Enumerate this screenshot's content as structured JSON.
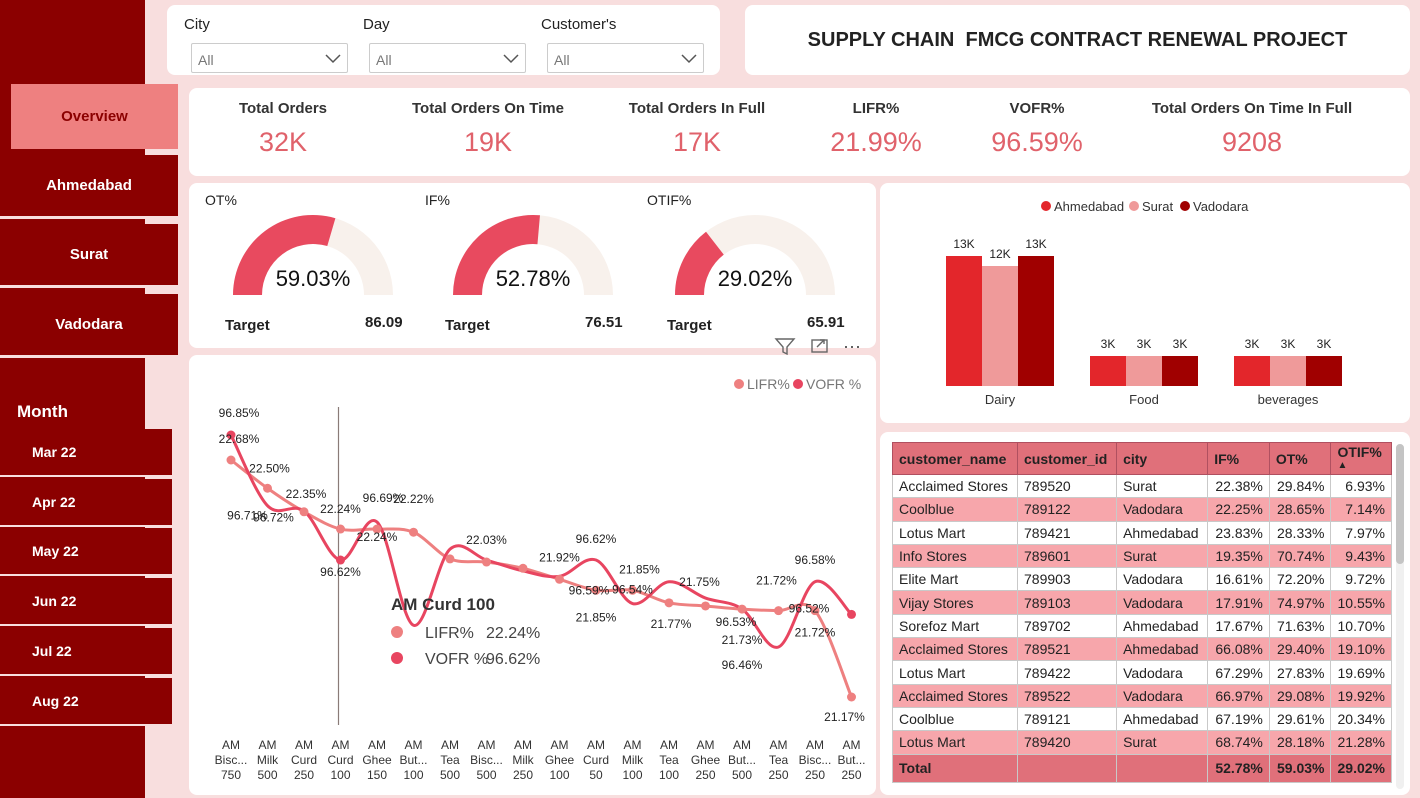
{
  "title": "SUPPLY CHAIN  FMCG CONTRACT RENEWAL PROJECT",
  "filters": [
    {
      "label": "City",
      "value": "All"
    },
    {
      "label": "Day",
      "value": "All"
    },
    {
      "label": "Customer's",
      "value": "All"
    }
  ],
  "nav": [
    "Overview",
    "Ahmedabad",
    "Surat",
    "Vadodara"
  ],
  "month_title": "Month",
  "months": [
    "Mar 22",
    "Apr 22",
    "May 22",
    "Jun 22",
    "Jul 22",
    "Aug 22"
  ],
  "kpis": [
    {
      "label": "Total Orders",
      "value": "32K"
    },
    {
      "label": "Total Orders On Time",
      "value": "19K"
    },
    {
      "label": "Total Orders In Full",
      "value": "17K"
    },
    {
      "label": "LIFR%",
      "value": "21.99%"
    },
    {
      "label": "VOFR%",
      "value": "96.59%"
    },
    {
      "label": "Total Orders On Time In Full",
      "value": "9208"
    }
  ],
  "gauges": [
    {
      "title": "OT%",
      "value": "59.03%",
      "fraction": 0.5903,
      "target_label": "Target",
      "target": "86.09"
    },
    {
      "title": "IF%",
      "value": "52.78%",
      "fraction": 0.5278,
      "target_label": "Target",
      "target": "76.51"
    },
    {
      "title": "OTIF%",
      "value": "29.02%",
      "fraction": 0.2902,
      "target_label": "Target",
      "target": "65.91"
    }
  ],
  "colors": {
    "sidebar": "#8b0000",
    "accent": "#e0626b",
    "ahmedabad": "#e3262b",
    "surat": "#ef9a9a",
    "vadodara": "#a00000",
    "lifr": "#ee8080",
    "vofr": "#e84560"
  },
  "chart_data": [
    {
      "type": "line",
      "title": "",
      "legend": [
        "LIFR%",
        "VOFR %"
      ],
      "x": [
        "AM Bisc... 750",
        "AM Milk 500",
        "AM Curd 250",
        "AM Curd 100",
        "AM Ghee 150",
        "AM But... 100",
        "AM Tea 500",
        "AM Bisc... 500",
        "AM Milk 250",
        "AM Ghee 100",
        "AM Curd 50",
        "AM Milk 100",
        "AM Tea 100",
        "AM Ghee 250",
        "AM But... 500",
        "AM Tea 250",
        "AM Bisc... 250",
        "AM But... 250"
      ],
      "x_lines": [
        [
          "AM",
          "Bisc...",
          "750"
        ],
        [
          "AM",
          "Milk",
          "500"
        ],
        [
          "AM",
          "Curd",
          "250"
        ],
        [
          "AM",
          "Curd",
          "100"
        ],
        [
          "AM",
          "Ghee",
          "150"
        ],
        [
          "AM",
          "But...",
          "100"
        ],
        [
          "AM",
          "Tea",
          "500"
        ],
        [
          "AM",
          "Bisc...",
          "500"
        ],
        [
          "AM",
          "Milk",
          "250"
        ],
        [
          "AM",
          "Ghee",
          "100"
        ],
        [
          "AM",
          "Curd",
          "50"
        ],
        [
          "AM",
          "Milk",
          "100"
        ],
        [
          "AM",
          "Tea",
          "100"
        ],
        [
          "AM",
          "Ghee",
          "250"
        ],
        [
          "AM",
          "But...",
          "500"
        ],
        [
          "AM",
          "Tea",
          "250"
        ],
        [
          "AM",
          "Bisc...",
          "250"
        ],
        [
          "AM",
          "But...",
          "250"
        ]
      ],
      "series": [
        {
          "name": "LIFR%",
          "values": [
            22.68,
            22.5,
            22.35,
            22.24,
            22.24,
            22.22,
            22.05,
            22.03,
            21.99,
            21.92,
            21.85,
            21.85,
            21.77,
            21.75,
            21.73,
            21.72,
            21.72,
            21.17
          ]
        },
        {
          "name": "VOFR %",
          "values": [
            96.85,
            96.72,
            96.71,
            96.62,
            96.69,
            96.5,
            96.64,
            96.62,
            96.6,
            96.59,
            96.62,
            96.54,
            96.58,
            96.55,
            96.53,
            96.46,
            96.58,
            96.52
          ]
        }
      ],
      "data_labels": [
        {
          "text": "96.85%",
          "i": 0,
          "s": 1,
          "dx": 8,
          "dy": -18
        },
        {
          "text": "22.68%",
          "i": 0,
          "s": 0,
          "dx": 8,
          "dy": -17
        },
        {
          "text": "22.50%",
          "i": 1,
          "s": 0,
          "dx": 2,
          "dy": -16
        },
        {
          "text": "96.72%",
          "i": 1,
          "s": 1,
          "dx": 6,
          "dy": 16
        },
        {
          "text": "96.71%",
          "i": 1,
          "s": 0,
          "dx": -20,
          "dy": 31
        },
        {
          "text": "22.35%",
          "i": 2,
          "s": 0,
          "dx": 2,
          "dy": -14
        },
        {
          "text": "22.24%",
          "i": 3,
          "s": 0,
          "dx": 0,
          "dy": -16
        },
        {
          "text": "96.62%",
          "i": 3,
          "s": 1,
          "dx": 0,
          "dy": 16
        },
        {
          "text": "96.69%",
          "i": 4,
          "s": 1,
          "dx": 6,
          "dy": -20
        },
        {
          "text": "22.24%",
          "i": 4,
          "s": 0,
          "dx": 0,
          "dy": 12
        },
        {
          "text": "22.22%",
          "i": 5,
          "s": 0,
          "dx": 0,
          "dy": -29
        },
        {
          "text": "22.03%",
          "i": 7,
          "s": 0,
          "dx": 0,
          "dy": -18
        },
        {
          "text": "21.92%",
          "i": 9,
          "s": 0,
          "dx": 0,
          "dy": -18
        },
        {
          "text": "96.62%",
          "i": 10,
          "s": 1,
          "dx": 0,
          "dy": -17
        },
        {
          "text": "96.59%",
          "i": 10,
          "s": 0,
          "dx": -7,
          "dy": 4
        },
        {
          "text": "21.85%",
          "i": 10,
          "s": 0,
          "dx": 0,
          "dy": 31
        },
        {
          "text": "21.85%",
          "i": 11,
          "s": 0,
          "dx": 7,
          "dy": -17
        },
        {
          "text": "96.54%",
          "i": 11,
          "s": 0,
          "dx": 0,
          "dy": 3
        },
        {
          "text": "21.77%",
          "i": 12,
          "s": 0,
          "dx": 2,
          "dy": 25
        },
        {
          "text": "21.75%",
          "i": 13,
          "s": 0,
          "dx": -6,
          "dy": -20
        },
        {
          "text": "96.53%",
          "i": 14,
          "s": 0,
          "dx": -6,
          "dy": 17
        },
        {
          "text": "21.73%",
          "i": 14,
          "s": 0,
          "dx": 0,
          "dy": 35
        },
        {
          "text": "96.46%",
          "i": 14,
          "s": 0,
          "dx": 0,
          "dy": 60
        },
        {
          "text": "21.72%",
          "i": 15,
          "s": 0,
          "dx": -2,
          "dy": -26
        },
        {
          "text": "96.52%",
          "i": 16,
          "s": 0,
          "dx": -6,
          "dy": 2
        },
        {
          "text": "96.58%",
          "i": 16,
          "s": 1,
          "dx": 0,
          "dy": -18
        },
        {
          "text": "21.72%",
          "i": 16,
          "s": 0,
          "dx": 0,
          "dy": 26
        },
        {
          "text": "21.17%",
          "i": 17,
          "s": 0,
          "dx": -7,
          "dy": 24
        }
      ],
      "tooltip": {
        "title": "AM Curd 100",
        "rows": [
          {
            "name": "LIFR%",
            "value": "22.24%"
          },
          {
            "name": "VOFR %",
            "value": "96.62%"
          }
        ]
      },
      "grid": false,
      "legend_position": "top-right"
    },
    {
      "type": "bar",
      "title": "",
      "legend": [
        "Ahmedabad",
        "Surat",
        "Vadodara"
      ],
      "categories": [
        "Dairy",
        "Food",
        "beverages"
      ],
      "series": [
        {
          "name": "Ahmedabad",
          "values": [
            13000,
            3000,
            3000
          ],
          "labels": [
            "13K",
            "3K",
            "3K"
          ]
        },
        {
          "name": "Surat",
          "values": [
            12000,
            3000,
            3000
          ],
          "labels": [
            "12K",
            "3K",
            "3K"
          ]
        },
        {
          "name": "Vadodara",
          "values": [
            13000,
            3000,
            3000
          ],
          "labels": [
            "13K",
            "3K",
            "3K"
          ]
        }
      ],
      "legend_position": "top-center"
    }
  ],
  "table": {
    "headers": [
      "customer_name",
      "customer_id",
      "city",
      "IF%",
      "OT%",
      "OTIF%"
    ],
    "sort_indicator": "▲",
    "rows": [
      [
        "Acclaimed Stores",
        "789520",
        "Surat",
        "22.38%",
        "29.84%",
        "6.93%"
      ],
      [
        "Coolblue",
        "789122",
        "Vadodara",
        "22.25%",
        "28.65%",
        "7.14%"
      ],
      [
        "Lotus Mart",
        "789421",
        "Ahmedabad",
        "23.83%",
        "28.33%",
        "7.97%"
      ],
      [
        "Info Stores",
        "789601",
        "Surat",
        "19.35%",
        "70.74%",
        "9.43%"
      ],
      [
        "Elite Mart",
        "789903",
        "Vadodara",
        "16.61%",
        "72.20%",
        "9.72%"
      ],
      [
        "Vijay Stores",
        "789103",
        "Vadodara",
        "17.91%",
        "74.97%",
        "10.55%"
      ],
      [
        "Sorefoz Mart",
        "789702",
        "Ahmedabad",
        "17.67%",
        "71.63%",
        "10.70%"
      ],
      [
        "Acclaimed Stores",
        "789521",
        "Ahmedabad",
        "66.08%",
        "29.40%",
        "19.10%"
      ],
      [
        "Lotus Mart",
        "789422",
        "Vadodara",
        "67.29%",
        "27.83%",
        "19.69%"
      ],
      [
        "Acclaimed Stores",
        "789522",
        "Vadodara",
        "66.97%",
        "29.08%",
        "19.92%"
      ],
      [
        "Coolblue",
        "789121",
        "Ahmedabad",
        "67.19%",
        "29.61%",
        "20.34%"
      ],
      [
        "Lotus Mart",
        "789420",
        "Surat",
        "68.74%",
        "28.18%",
        "21.28%"
      ]
    ],
    "total": [
      "Total",
      "",
      "",
      "52.78%",
      "59.03%",
      "29.02%"
    ]
  }
}
